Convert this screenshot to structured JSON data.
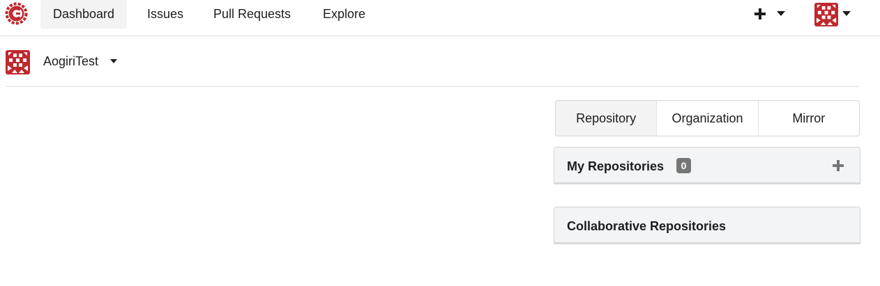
{
  "topbar": {
    "logo_icon": "gitea-logo-icon",
    "nav": [
      {
        "label": "Dashboard",
        "active": true
      },
      {
        "label": "Issues"
      },
      {
        "label": "Pull Requests"
      },
      {
        "label": "Explore"
      }
    ],
    "create_icon": "plus-icon",
    "user_avatar_icon": "user-avatar-icon"
  },
  "context": {
    "name": "AogiriTest",
    "avatar_icon": "org-avatar-icon"
  },
  "tabs": [
    {
      "label": "Repository",
      "active": true
    },
    {
      "label": "Organization"
    },
    {
      "label": "Mirror"
    }
  ],
  "panels": {
    "my_repositories": {
      "title": "My Repositories",
      "count": "0"
    },
    "collaborative_repositories": {
      "title": "Collaborative Repositories"
    }
  },
  "colors": {
    "brand": "#c0282e",
    "active_bg": "#f3f3f3",
    "badge": "#767676"
  }
}
